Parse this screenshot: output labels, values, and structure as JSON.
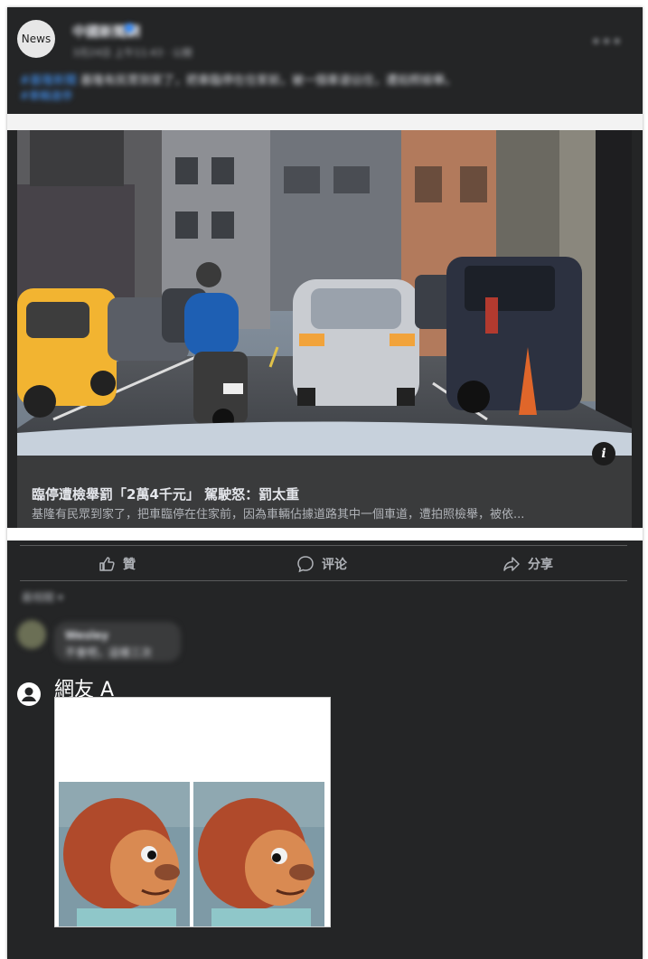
{
  "post": {
    "avatar_label": "News",
    "page_name": "中國新聞網",
    "meta": "3月24日 上午11:43 · 公開",
    "text": "基隆有民眾到家了，把車臨停在住家前，被一個車道佔住，遭拍照檢舉。",
    "text_link": "#基隆新聞",
    "sub_link": "#車輛違停",
    "more_icon": "more-icon"
  },
  "link_preview": {
    "headline": "臨停遭檢舉罰「2萬4千元」 駕駛怒：罰太重",
    "summary": "基隆有民眾到家了，把車臨停在住家前，因為車輛佔據道路其中一個車道，遭拍照檢舉，被依...",
    "info_icon": "info-icon",
    "info_label": "i"
  },
  "actions": {
    "like": "贊",
    "comment": "评论",
    "share": "分享"
  },
  "comments": {
    "sort_label": "最相關 ▾",
    "first": {
      "name": "Wesley",
      "text": "不會吧，這樣三次"
    },
    "second": {
      "name": "網友 A"
    }
  }
}
